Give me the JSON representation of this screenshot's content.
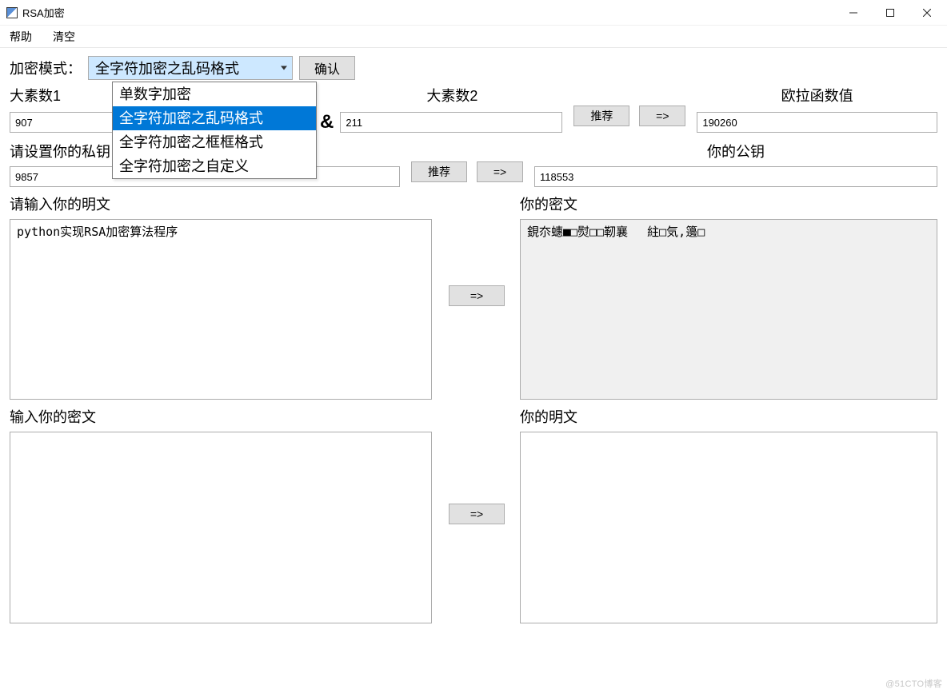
{
  "window": {
    "title": "RSA加密"
  },
  "menubar": {
    "help": "帮助",
    "clear": "清空"
  },
  "mode": {
    "label": "加密模式：",
    "selected": "全字符加密之乱码格式",
    "options": {
      "opt0": "单数字加密",
      "opt1": "全字符加密之乱码格式",
      "opt2": "全字符加密之框框格式",
      "opt3": "全字符加密之自定义"
    },
    "confirm": "确认"
  },
  "primes": {
    "p_label": "大素数1",
    "q_label": "大素数2",
    "and": "&",
    "p_value": "907",
    "q_value": "211",
    "recommend": "推荐",
    "arrow": "=>",
    "euler_label": "欧拉函数值",
    "euler_value": "190260"
  },
  "keys": {
    "priv_label": "请设置你的私钥",
    "priv_value": "9857",
    "recommend": "推荐",
    "arrow": "=>",
    "pub_label": "你的公钥",
    "pub_value": "118553"
  },
  "enc": {
    "plain_label": "请输入你的明文",
    "plain_value": "python实现RSA加密算法程序",
    "arrow": "=>",
    "cipher_label": "你的密文",
    "cipher_value": "鋧夵蟪■□熨□□靭襄　 紸□気,籩□"
  },
  "dec": {
    "cipher_label": "输入你的密文",
    "cipher_value": "",
    "arrow": "=>",
    "plain_label": "你的明文",
    "plain_value": ""
  },
  "watermark": "@51CTO博客"
}
